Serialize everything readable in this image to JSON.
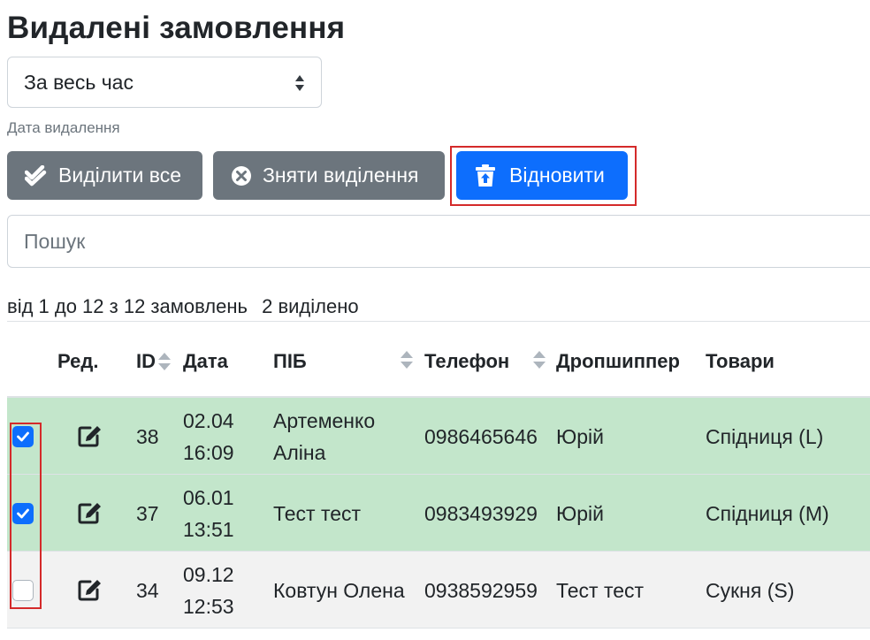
{
  "page": {
    "title": "Видалені замовлення"
  },
  "filter": {
    "period_value": "За весь час",
    "period_help": "Дата видалення"
  },
  "toolbar": {
    "select_all_label": "Виділити все",
    "deselect_label": "Зняти виділення",
    "restore_label": "Відновити"
  },
  "search": {
    "placeholder": "Пошук",
    "value": ""
  },
  "summary": {
    "range_text": "від 1 до 12 з 12 замовлень",
    "selected_text": "2 виділено"
  },
  "table": {
    "headers": {
      "edit": "Ред.",
      "id": "ID",
      "date": "Дата",
      "name": "ПІБ",
      "phone": "Телефон",
      "dropshipper": "Дропшиппер",
      "goods": "Товари"
    },
    "rows": [
      {
        "checked": true,
        "id": "38",
        "date": "02.04",
        "time": "16:09",
        "name_line1": "Артеменко",
        "name_line2": "Аліна",
        "phone": "0986465646",
        "dropshipper": "Юрій",
        "goods": "Спідниця (L)"
      },
      {
        "checked": true,
        "id": "37",
        "date": "06.01",
        "time": "13:51",
        "name_line1": "Тест тест",
        "name_line2": "",
        "phone": "0983493929",
        "dropshipper": "Юрій",
        "goods": "Спідниця (M)"
      },
      {
        "checked": false,
        "id": "34",
        "date": "09.12",
        "time": "12:53",
        "name_line1": "Ковтун Олена",
        "name_line2": "",
        "phone": "0938592959",
        "dropshipper": "Тест тест",
        "goods": "Сукня (S)"
      }
    ]
  },
  "colors": {
    "primary": "#0d6efd",
    "secondary": "#6c757d",
    "selected_row": "#c3e6cb",
    "plain_row": "#f2f2f2",
    "highlight": "#d42a2a"
  },
  "icons": {
    "select_all": "double-check-icon",
    "deselect": "circle-x-icon",
    "restore": "trash-restore-icon",
    "edit": "edit-icon",
    "sort": "sort-arrows-icon",
    "select_arrows": "select-arrows-icon"
  }
}
